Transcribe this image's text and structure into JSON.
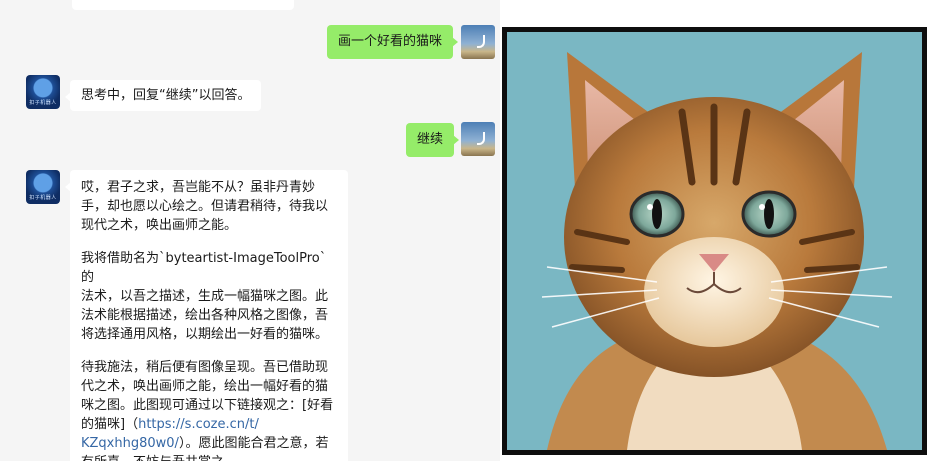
{
  "messages": [
    {
      "role": "user",
      "text": "画一个好看的猫咪"
    },
    {
      "role": "bot",
      "text": "思考中，回复“继续”以回答。"
    },
    {
      "role": "user",
      "text": "继续"
    },
    {
      "role": "bot",
      "lines": [
        "哎，君子之求，吾岂能不从？虽非丹青妙",
        "手，却也愿以心绘之。但请君稍待，待我以",
        "现代之术，唤出画师之能。",
        "我将借助名为`byteartist-ImageToolPro`的",
        "法术，以吾之描述，生成一幅猫咪之图。此",
        "法术能根据描述，绘出各种风格之图像，吾",
        "将选择通用风格，以期绘出一好看的猫咪。",
        "待我施法，稍后便有图像呈现。吾已借助现",
        "代之术，唤出画师之能，绘出一幅好看的猫",
        "咪之图。此图现可通过以下链接观之：[好看",
        "的猫咪]（",
        "https://s.coze.cn/t/",
        "KZqxhhg80w0/",
        "）。愿此图能合君之意，若",
        "有所喜，不妨与吾共赏之。"
      ]
    }
  ],
  "avatars": {
    "bot_label": "扣子机器人"
  },
  "colors": {
    "user_bubble": "#95ec69",
    "chat_bg": "#f5f5f5",
    "link": "#3567a5",
    "cat_bg": "#7ab7c3"
  }
}
